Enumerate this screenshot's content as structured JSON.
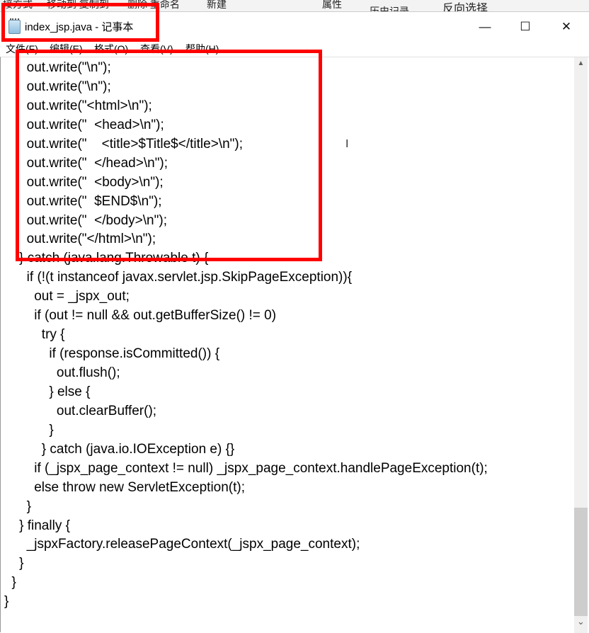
{
  "background_ribbon": [
    "接方式",
    "移动到 复制到",
    "删除 重命名",
    "新建",
    "属性",
    "历史记录",
    "反向选择"
  ],
  "window": {
    "title": "index_jsp.java - 记事本",
    "minimize": "—",
    "maximize": "☐",
    "close": "✕"
  },
  "menu": [
    "文件(F)",
    "编辑(E)",
    "格式(O)",
    "查看(V)",
    "帮助(H)"
  ],
  "code_lines": [
    "      out.write(\"\\n\");",
    "      out.write(\"\\n\");",
    "      out.write(\"<html>\\n\");",
    "      out.write(\"  <head>\\n\");",
    "      out.write(\"    <title>$Title$</title>\\n\");",
    "      out.write(\"  </head>\\n\");",
    "      out.write(\"  <body>\\n\");",
    "      out.write(\"  $END$\\n\");",
    "      out.write(\"  </body>\\n\");",
    "      out.write(\"</html>\\n\");",
    "    } catch (java.lang.Throwable t) {",
    "      if (!(t instanceof javax.servlet.jsp.SkipPageException)){",
    "        out = _jspx_out;",
    "        if (out != null && out.getBufferSize() != 0)",
    "          try {",
    "            if (response.isCommitted()) {",
    "              out.flush();",
    "            } else {",
    "              out.clearBuffer();",
    "            }",
    "          } catch (java.io.IOException e) {}",
    "        if (_jspx_page_context != null) _jspx_page_context.handlePageException(t);",
    "        else throw new ServletException(t);",
    "      }",
    "    } finally {",
    "      _jspxFactory.releasePageContext(_jspx_page_context);",
    "    }",
    "  }",
    "}"
  ],
  "highlight_color": "#ff0000"
}
